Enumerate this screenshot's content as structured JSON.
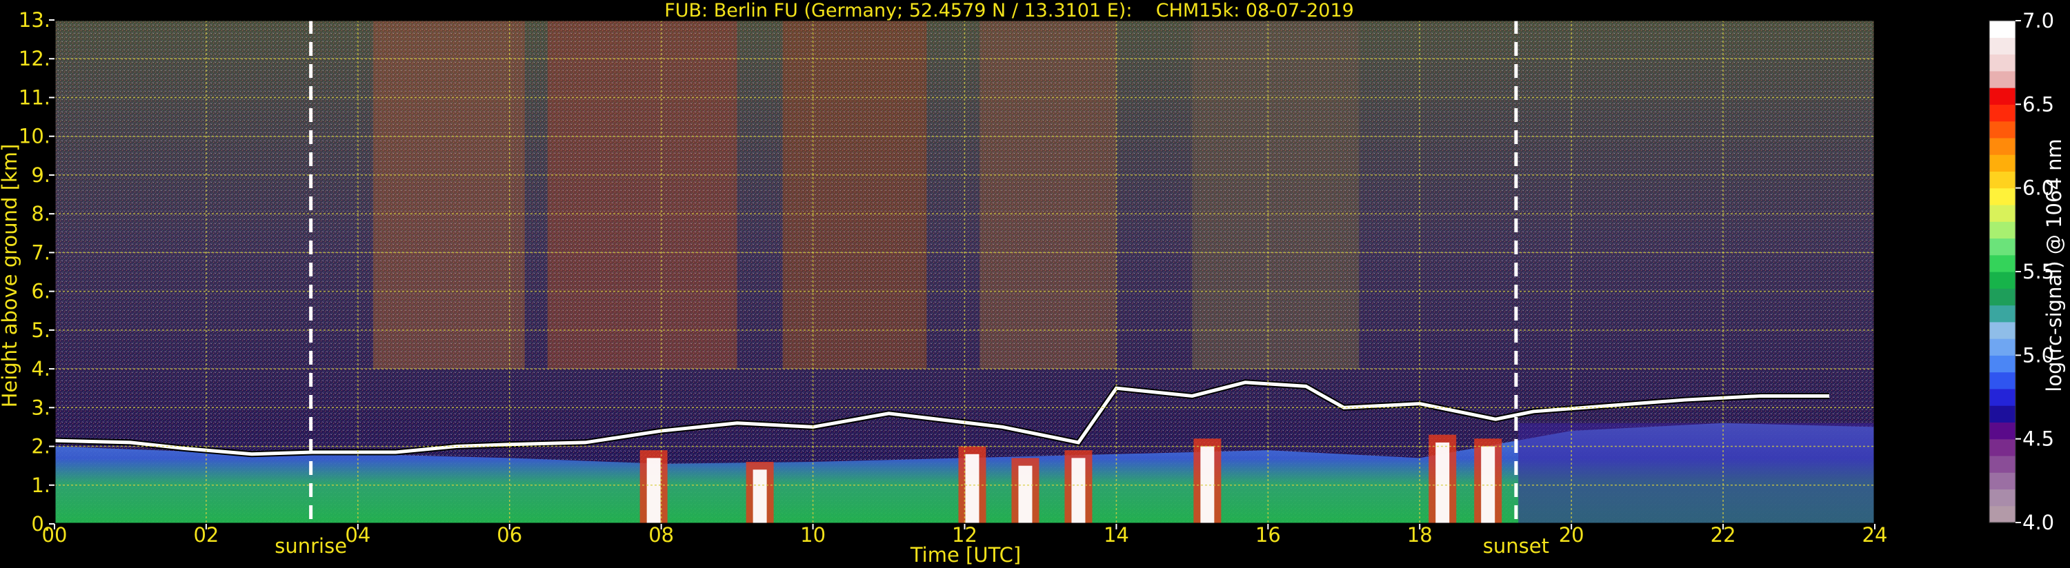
{
  "chart_data": {
    "type": "heatmap",
    "title": "FUB: Berlin FU (Germany; 52.4579 N / 13.3101 E):    CHM15k: 08-07-2019",
    "xlabel": "Time [UTC]",
    "ylabel": "Height above ground [km]",
    "xlim": [
      0,
      24
    ],
    "ylim": [
      0,
      13
    ],
    "x_ticks": [
      "00",
      "02",
      "04",
      "06",
      "08",
      "10",
      "12",
      "14",
      "16",
      "18",
      "20",
      "22",
      "24"
    ],
    "y_ticks": [
      "0.",
      "1.",
      "2.",
      "3.",
      "4.",
      "5.",
      "6.",
      "7.",
      "8.",
      "9.",
      "10.",
      "11.",
      "12.",
      "13."
    ],
    "grid": true,
    "markers": [
      {
        "label": "sunrise",
        "x": 3.38
      },
      {
        "label": "sunset",
        "x": 19.27
      }
    ],
    "colorbar": {
      "label": "log(rc-signal) @ 1064 nm",
      "range": [
        4.0,
        7.0
      ],
      "ticks": [
        "4.0",
        "4.5",
        "5.0",
        "5.5",
        "6.0",
        "6.5",
        "7.0"
      ],
      "colors": [
        "#b39aa8",
        "#a98caa",
        "#9b6fa3",
        "#8a4d97",
        "#7a2b8c",
        "#5a0a8a",
        "#1c0f9c",
        "#2424d8",
        "#2f55f0",
        "#4b86f5",
        "#6fa6f2",
        "#8fbde8",
        "#3aa6a0",
        "#1e9e5a",
        "#17b34a",
        "#34d35a",
        "#6be37a",
        "#a8f070",
        "#d9f25a",
        "#fff23a",
        "#ffd21e",
        "#ffae0a",
        "#ff8a0a",
        "#ff5a0a",
        "#ff2a0a",
        "#f00a0a",
        "#e8b0b0",
        "#f2d4d4",
        "#f6e8e8",
        "#ffffff"
      ]
    },
    "cloud_base_km": [
      {
        "x": 0.0,
        "y": 2.15
      },
      {
        "x": 1.0,
        "y": 2.1
      },
      {
        "x": 1.7,
        "y": 1.95
      },
      {
        "x": 2.6,
        "y": 1.8
      },
      {
        "x": 3.4,
        "y": 1.85
      },
      {
        "x": 4.5,
        "y": 1.85
      },
      {
        "x": 5.3,
        "y": 2.0
      },
      {
        "x": 6.0,
        "y": 2.05
      },
      {
        "x": 7.0,
        "y": 2.1
      },
      {
        "x": 8.0,
        "y": 2.4
      },
      {
        "x": 9.0,
        "y": 2.6
      },
      {
        "x": 10.0,
        "y": 2.5
      },
      {
        "x": 11.0,
        "y": 2.85
      },
      {
        "x": 12.5,
        "y": 2.5
      },
      {
        "x": 13.5,
        "y": 2.1
      },
      {
        "x": 14.0,
        "y": 3.5
      },
      {
        "x": 15.0,
        "y": 3.3
      },
      {
        "x": 15.7,
        "y": 3.65
      },
      {
        "x": 16.5,
        "y": 3.55
      },
      {
        "x": 17.0,
        "y": 3.0
      },
      {
        "x": 18.0,
        "y": 3.1
      },
      {
        "x": 19.0,
        "y": 2.7
      },
      {
        "x": 19.5,
        "y": 2.9
      },
      {
        "x": 20.5,
        "y": 3.05
      },
      {
        "x": 21.5,
        "y": 3.2
      },
      {
        "x": 22.5,
        "y": 3.3
      },
      {
        "x": 23.4,
        "y": 3.3
      }
    ],
    "boundary_layer_top_km": [
      {
        "x": 0.0,
        "y": 2.0
      },
      {
        "x": 2.0,
        "y": 1.85
      },
      {
        "x": 4.0,
        "y": 1.8
      },
      {
        "x": 6.0,
        "y": 1.7
      },
      {
        "x": 8.0,
        "y": 1.55
      },
      {
        "x": 10.0,
        "y": 1.6
      },
      {
        "x": 12.0,
        "y": 1.7
      },
      {
        "x": 14.0,
        "y": 1.8
      },
      {
        "x": 16.0,
        "y": 1.9
      },
      {
        "x": 18.0,
        "y": 1.7
      },
      {
        "x": 20.0,
        "y": 2.4
      },
      {
        "x": 22.0,
        "y": 2.6
      },
      {
        "x": 24.0,
        "y": 2.5
      }
    ],
    "precip_columns": [
      {
        "x": 7.9,
        "top": 1.9
      },
      {
        "x": 9.3,
        "top": 1.6
      },
      {
        "x": 12.1,
        "top": 2.0
      },
      {
        "x": 12.8,
        "top": 1.7
      },
      {
        "x": 13.5,
        "top": 1.9
      },
      {
        "x": 15.2,
        "top": 2.2
      },
      {
        "x": 18.3,
        "top": 2.3
      },
      {
        "x": 18.9,
        "top": 2.2
      }
    ]
  }
}
